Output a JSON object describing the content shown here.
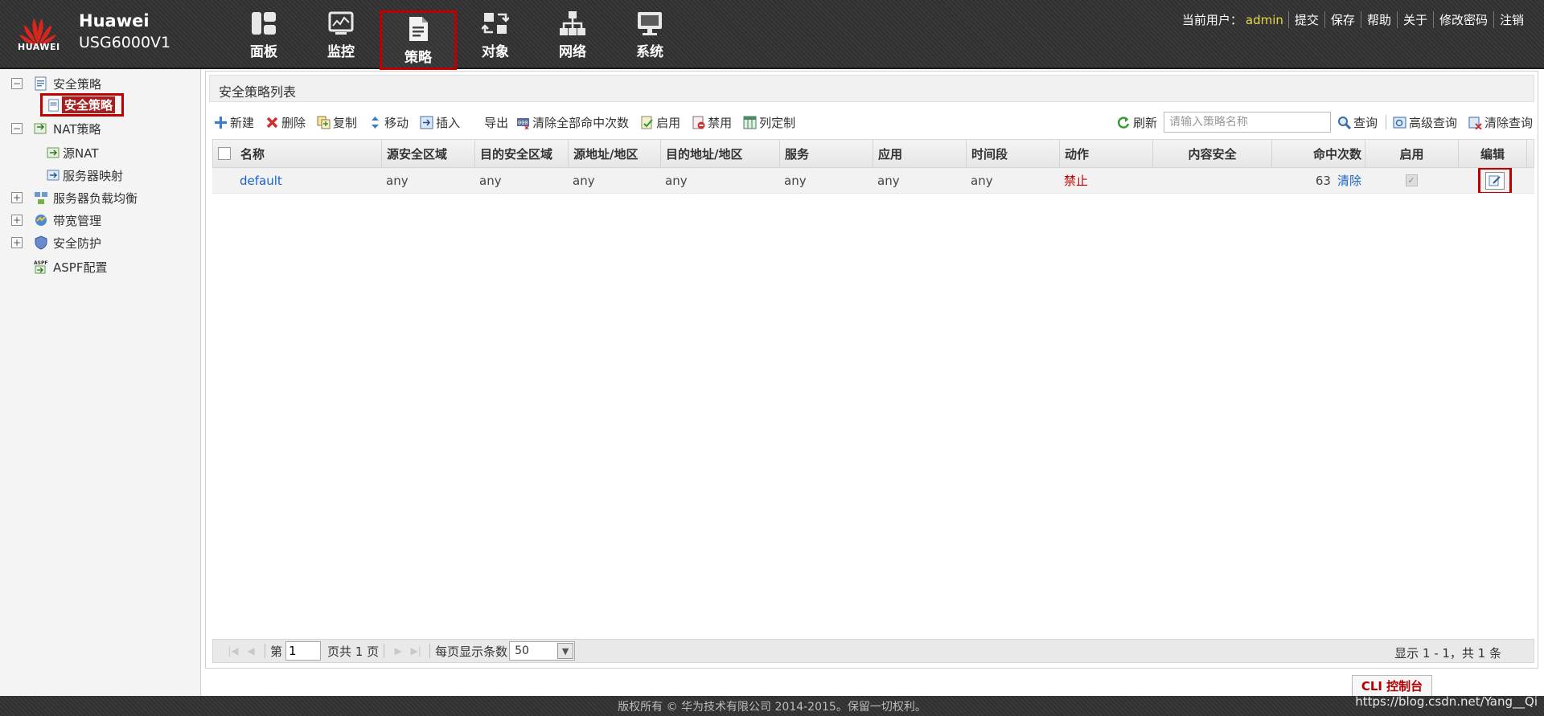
{
  "brand": {
    "logo_text": "HUAWEI",
    "title": "Huawei",
    "model": "USG6000V1"
  },
  "nav": {
    "items": [
      {
        "label": "面板",
        "icon": "dashboard-icon"
      },
      {
        "label": "监控",
        "icon": "monitor-icon"
      },
      {
        "label": "策略",
        "icon": "policy-icon",
        "active": true
      },
      {
        "label": "对象",
        "icon": "object-icon"
      },
      {
        "label": "网络",
        "icon": "network-icon"
      },
      {
        "label": "系统",
        "icon": "system-icon"
      }
    ]
  },
  "userbar": {
    "current_user_label": "当前用户：",
    "username": "admin",
    "links": [
      "提交",
      "保存",
      "帮助",
      "关于",
      "修改密码",
      "注销"
    ]
  },
  "sidebar": {
    "items": [
      {
        "label": "安全策略",
        "toggle": "−"
      },
      {
        "label": "安全策略",
        "selected": true
      },
      {
        "label": "NAT策略",
        "toggle": "−"
      },
      {
        "label": "源NAT"
      },
      {
        "label": "服务器映射"
      },
      {
        "label": "服务器负载均衡",
        "toggle": "+"
      },
      {
        "label": "带宽管理",
        "toggle": "+"
      },
      {
        "label": "安全防护",
        "toggle": "+"
      },
      {
        "label": "ASPF配置"
      }
    ],
    "aspf_icon_text": "ASPF"
  },
  "panel": {
    "title": "安全策略列表"
  },
  "toolbar": {
    "new": "新建",
    "delete": "删除",
    "copy": "复制",
    "move": "移动",
    "insert": "插入",
    "export": "导出",
    "clear_hits": "清除全部命中次数",
    "enable": "启用",
    "disable": "禁用",
    "columns": "列定制",
    "refresh": "刷新",
    "search_placeholder": "请输入策略名称",
    "query": "查询",
    "advanced_query": "高级查询",
    "clear_query": "清除查询"
  },
  "table": {
    "columns": [
      "名称",
      "源安全区域",
      "目的安全区域",
      "源地址/地区",
      "目的地址/地区",
      "服务",
      "应用",
      "时间段",
      "动作",
      "内容安全",
      "命中次数",
      "启用",
      "编辑"
    ],
    "rows": [
      {
        "name": "default",
        "src_zone": "any",
        "dst_zone": "any",
        "src_addr": "any",
        "dst_addr": "any",
        "service": "any",
        "application": "any",
        "time_range": "any",
        "action": "禁止",
        "content_security": "",
        "hits": "63",
        "clear": "清除",
        "enabled": true
      }
    ]
  },
  "pager": {
    "page_prefix": "第",
    "page_value": "1",
    "page_suffix": "页共 1 页",
    "per_page_label": "每页显示条数",
    "per_page_value": "50",
    "info": "显示 1 - 1，共 1 条"
  },
  "cli_button": "CLI 控制台",
  "footer": {
    "copyright": "版权所有 © 华为技术有限公司 2014-2015。保留一切权利。",
    "watermark": "https://blog.csdn.net/Yang__Qi"
  },
  "colors": {
    "accent_red": "#c00000",
    "link_blue": "#1a63c6",
    "username_yellow": "#e9d84b"
  }
}
